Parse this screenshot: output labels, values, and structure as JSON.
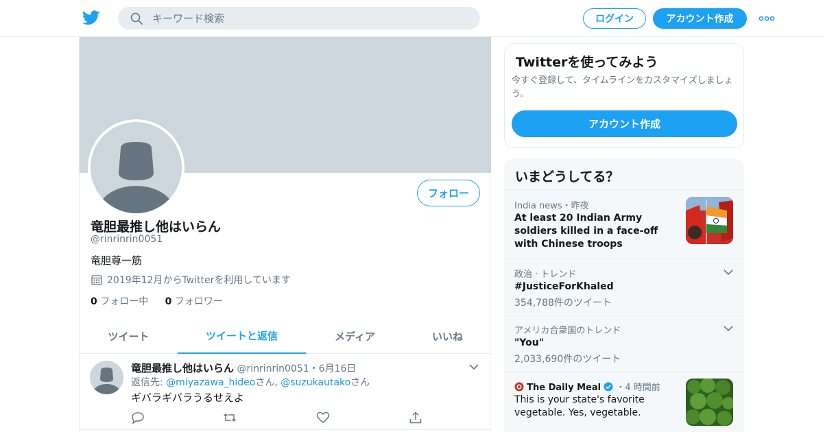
{
  "header": {
    "search_placeholder": "キーワード検索",
    "login_label": "ログイン",
    "signup_label": "アカウント作成",
    "brand_color": "#1da1f2"
  },
  "profile": {
    "name": "竜胆最推し他はいらん",
    "handle": "@rinrinrin0051",
    "bio": "竜胆尊一筋",
    "joined": "2019年12月からTwitterを利用しています",
    "following_count": "0",
    "following_label": "フォロー中",
    "followers_count": "0",
    "followers_label": "フォロワー",
    "follow_button": "フォロー"
  },
  "tabs": [
    {
      "label": "ツイート"
    },
    {
      "label": "ツイートと返信"
    },
    {
      "label": "メディア"
    },
    {
      "label": "いいね"
    }
  ],
  "tweet": {
    "name": "竜胆最推し他はいらん",
    "meta": "@rinrinrin0051・6月16日",
    "reply_prefix": "返信先: ",
    "reply_user1": "@miyazawa_hideo",
    "reply_san1": "さん, ",
    "reply_user2": "@suzukautako",
    "reply_san2": "さん",
    "text": "ギバラギバラうるせえよ"
  },
  "signup_card": {
    "title": "Twitterを使ってみよう",
    "desc": "今すぐ登録して、タイムラインをカスタマイズしましょう。",
    "button": "アカウント作成"
  },
  "trends": {
    "heading": "いまどうしてる？",
    "items": [
      {
        "meta": "India news・昨夜",
        "title": "At least 20 Indian Army soldiers killed in a face-off with Chinese troops"
      },
      {
        "meta": "政治 · トレンド",
        "title": "#JusticeForKhaled",
        "count": "354,788件のツイート"
      },
      {
        "meta": "アメリカ合衆国のトレンド",
        "title": "\"You\"",
        "count": "2,033,690件のツイート"
      },
      {
        "source": "The Daily Meal",
        "time": "・4 時間前",
        "title": "This is your state's favorite vegetable. Yes, vegetable."
      }
    ]
  }
}
